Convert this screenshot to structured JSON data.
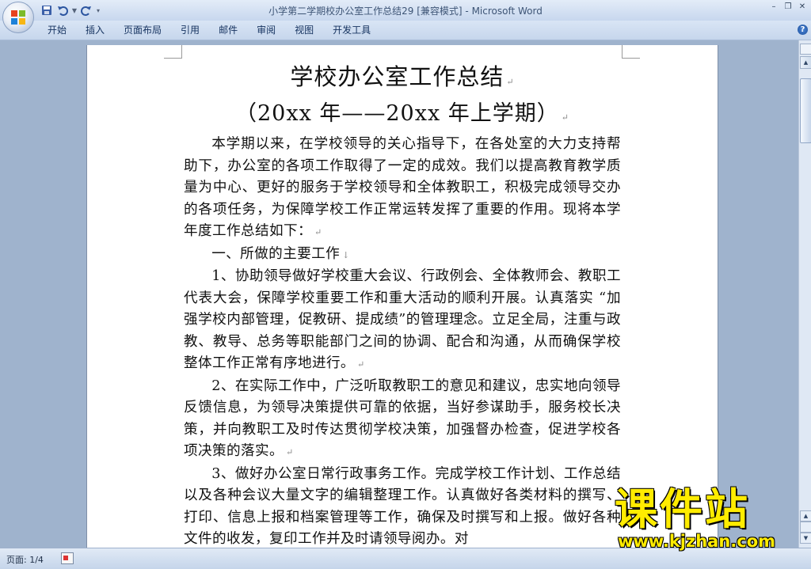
{
  "titlebar": {
    "title": "小学第二学期校办公室工作总结29 [兼容模式]",
    "separator": " - ",
    "app_name": "Microsoft Word"
  },
  "ribbon": {
    "tabs": [
      "开始",
      "插入",
      "页面布局",
      "引用",
      "邮件",
      "审阅",
      "视图",
      "开发工具"
    ]
  },
  "document": {
    "title": "学校办公室工作总结",
    "subtitle": "（20xx 年——20xx 年上学期）",
    "paragraphs": [
      "本学期以来，在学校领导的关心指导下，在各处室的大力支持帮助下，办公室的各项工作取得了一定的成效。我们以提高教育教学质量为中心、更好的服务于学校领导和全体教职工，积极完成领导交办的各项任务，为保障学校工作正常运转发挥了重要的作用。现将本学年度工作总结如下：",
      "一、所做的主要工作",
      "1、协助领导做好学校重大会议、行政例会、全体教师会、教职工代表大会，保障学校重要工作和重大活动的顺利开展。认真落实 “加强学校内部管理，促教研、提成绩”的管理理念。立足全局，注重与政教、教导、总务等职能部门之间的协调、配合和沟通，从而确保学校整体工作正常有序地进行。",
      "2、在实际工作中，广泛听取教职工的意见和建议，忠实地向领导反馈信息，为领导决策提供可靠的依据，当好参谋助手，服务校长决策，并向教职工及时传达贯彻学校决策，加强督办检查，促进学校各项决策的落实。",
      "3、做好办公室日常行政事务工作。完成学校工作计划、工作总结以及各种会议大量文字的编辑整理工作。认真做好各类材料的撰写、打印、信息上报和档案管理等工作，确保及时撰写和上报。做好各种文件的收发，复印工作并及时请领导阅办。对"
    ]
  },
  "statusbar": {
    "page_info": "页面: 1/4"
  },
  "watermark": {
    "main": "课件站",
    "url": "www.kjzhan.com"
  }
}
